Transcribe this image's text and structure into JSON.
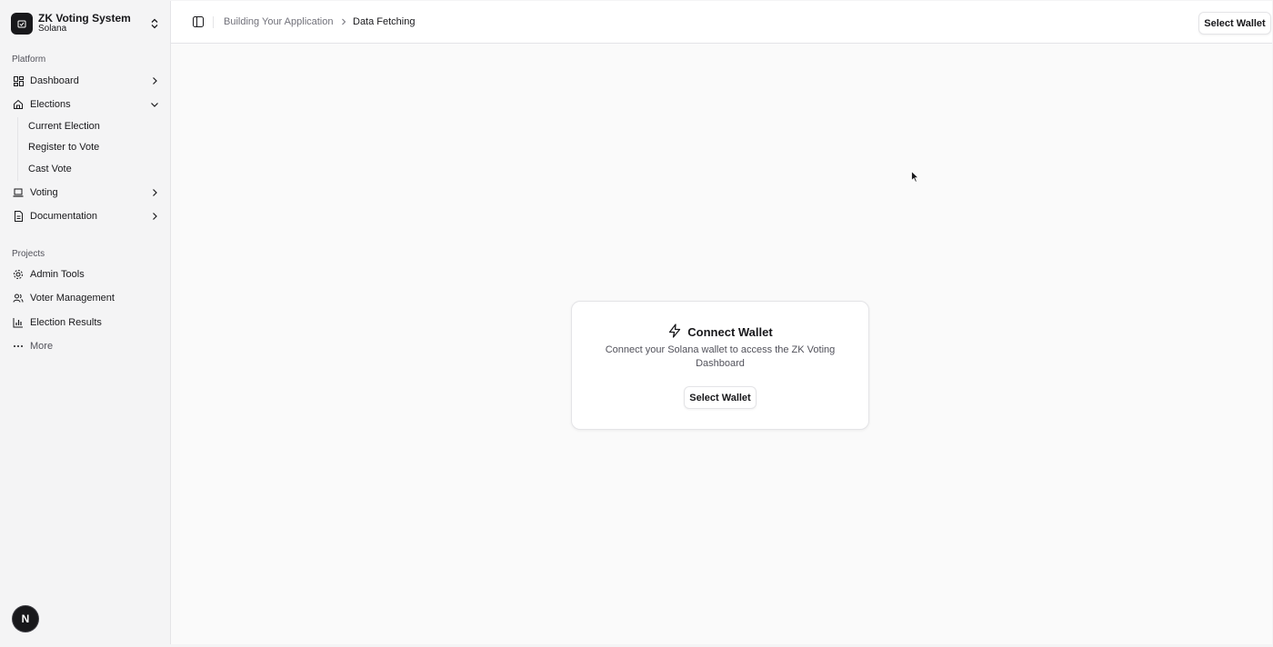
{
  "team": {
    "name": "ZK Voting System",
    "plan": "Solana"
  },
  "sidebar": {
    "platform_label": "Platform",
    "platform_items": [
      {
        "label": "Dashboard",
        "icon": "dashboard-grid-icon"
      },
      {
        "label": "Elections",
        "icon": "home-icon",
        "expanded": true
      },
      {
        "label": "Voting",
        "icon": "laptop-icon"
      },
      {
        "label": "Documentation",
        "icon": "document-icon"
      }
    ],
    "elections_sub_items": [
      "Current Election",
      "Register to Vote",
      "Cast Vote"
    ],
    "projects_label": "Projects",
    "project_items": [
      {
        "label": "Admin Tools",
        "icon": "gear-icon"
      },
      {
        "label": "Voter Management",
        "icon": "users-icon"
      },
      {
        "label": "Election Results",
        "icon": "bar-chart-icon"
      }
    ],
    "more_label": "More"
  },
  "header": {
    "breadcrumb": [
      "Building Your Application",
      "Data Fetching"
    ],
    "wallet_button": "Select Wallet"
  },
  "connect_card": {
    "title": "Connect Wallet",
    "description": "Connect your Solana wallet to access the ZK Voting Dashboard",
    "button": "Select Wallet"
  },
  "badge": {
    "letter": "N"
  },
  "colors": {
    "accent": "#18181b",
    "muted_text": "#71717a",
    "border": "#e4e4e7",
    "sidebar_bg": "#f4f4f5"
  }
}
